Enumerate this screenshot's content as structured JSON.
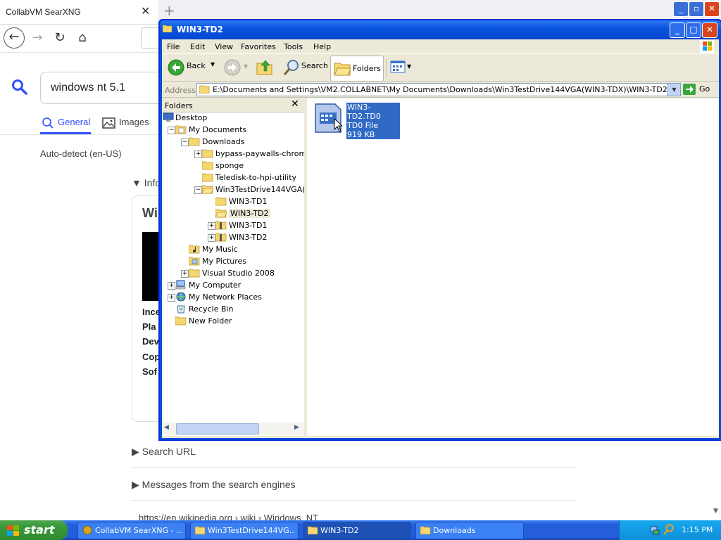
{
  "browser": {
    "tab_title": "CollabVM SearXNG",
    "tab_close": "✕",
    "new_tab": "+",
    "search_value": "windows nt 5.1",
    "tabs": {
      "general": "General",
      "images": "Images"
    },
    "autodetect": "Auto-detect (en-US)",
    "info_header": "▼ Info",
    "info_title": "Wi",
    "info_rows": [
      "Ince",
      "Pla",
      "Dev",
      "Cop",
      "Sof"
    ],
    "sections": {
      "search_url": "▶ Search URL",
      "messages": "▶ Messages from the search engines"
    },
    "wiki_url": "https://en.wikipedia.org › wiki › Windows_NT"
  },
  "explorer": {
    "title": "WIN3-TD2",
    "menus": [
      "File",
      "Edit",
      "View",
      "Favorites",
      "Tools",
      "Help"
    ],
    "toolbar": {
      "back": "Back",
      "search": "Search",
      "folders": "Folders"
    },
    "address_label": "Address",
    "address_value": "E:\\Documents and Settings\\VM2.COLLABNET\\My Documents\\Downloads\\Win3TestDrive144VGA(WIN3-TDX)\\WIN3-TD2",
    "go": "Go",
    "folders_pane_title": "Folders",
    "tree": [
      {
        "label": "Desktop",
        "level": 0,
        "exp": "",
        "icon": "desktop-icon"
      },
      {
        "label": "My Documents",
        "level": 1,
        "exp": "-",
        "icon": "my-documents-icon"
      },
      {
        "label": "Downloads",
        "level": 2,
        "exp": "-",
        "icon": "folder-icon"
      },
      {
        "label": "bypass-paywalls-chrome-clean",
        "level": 3,
        "exp": "+",
        "icon": "folder-icon"
      },
      {
        "label": "sponge",
        "level": 3,
        "exp": "",
        "icon": "folder-icon"
      },
      {
        "label": "Teledisk-to-hpi-utility",
        "level": 3,
        "exp": "",
        "icon": "folder-icon"
      },
      {
        "label": "Win3TestDrive144VGA(WIN3-TDX)",
        "level": 3,
        "exp": "-",
        "icon": "folder-open-icon"
      },
      {
        "label": "WIN3-TD1",
        "level": 4,
        "exp": "",
        "icon": "folder-icon"
      },
      {
        "label": "WIN3-TD2",
        "level": 4,
        "exp": "",
        "icon": "folder-open-icon",
        "selected": true
      },
      {
        "label": "WIN3-TD1",
        "level": 4,
        "exp": "+",
        "icon": "zip-folder-icon"
      },
      {
        "label": "WIN3-TD2",
        "level": 4,
        "exp": "+",
        "icon": "zip-folder-icon"
      },
      {
        "label": "My Music",
        "level": 2,
        "exp": "",
        "icon": "music-folder-icon"
      },
      {
        "label": "My Pictures",
        "level": 2,
        "exp": "",
        "icon": "pictures-folder-icon"
      },
      {
        "label": "Visual Studio 2008",
        "level": 2,
        "exp": "+",
        "icon": "folder-icon"
      },
      {
        "label": "My Computer",
        "level": 1,
        "exp": "+",
        "icon": "computer-icon"
      },
      {
        "label": "My Network Places",
        "level": 1,
        "exp": "+",
        "icon": "network-icon"
      },
      {
        "label": "Recycle Bin",
        "level": 1,
        "exp": "",
        "icon": "recycle-bin-icon"
      },
      {
        "label": "New Folder",
        "level": 1,
        "exp": "",
        "icon": "folder-icon"
      }
    ],
    "file": {
      "name": "WIN3-TD2.TD0",
      "type": "TD0 File",
      "size": "919 KB"
    }
  },
  "taskbar": {
    "start": "start",
    "tasks": [
      "CollabVM SearXNG - ...",
      "Win3TestDrive144VG...",
      "WIN3-TD2",
      "Downloads"
    ],
    "active_task": 2,
    "clock": "1:15 PM"
  },
  "colors": {
    "xp_blue": "#0a4ed8",
    "selection": "#316ac5",
    "start_green": "#3a9a3a",
    "searx_accent": "#3050ff"
  }
}
